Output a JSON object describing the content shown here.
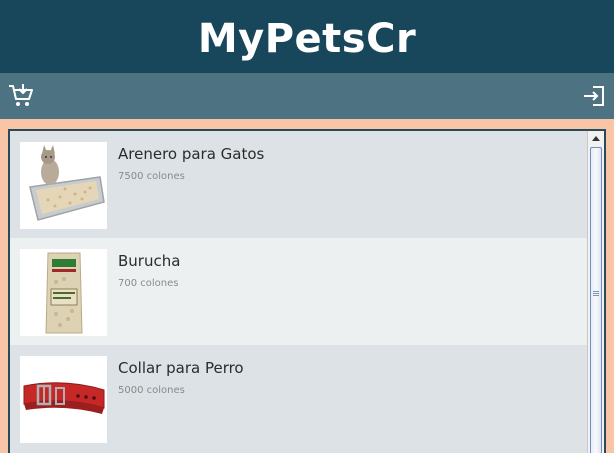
{
  "app": {
    "title": "MyPetsCr"
  },
  "toolbar": {
    "cart_icon": "cart-add-icon",
    "login_icon": "sign-in-icon"
  },
  "products": [
    {
      "name": "Arenero para Gatos",
      "price": "7500 colones",
      "image": "litter-box-with-cat"
    },
    {
      "name": "Burucha",
      "price": "700 colones",
      "image": "wood-shavings-bag"
    },
    {
      "name": "Collar para Perro",
      "price": "5000 colones",
      "image": "red-dog-collar"
    }
  ],
  "colors": {
    "header": "#18475b",
    "toolbar": "#4d7382",
    "background": "#f8c5a6",
    "row_odd": "#dce2e5",
    "row_even": "#edf0f1"
  }
}
